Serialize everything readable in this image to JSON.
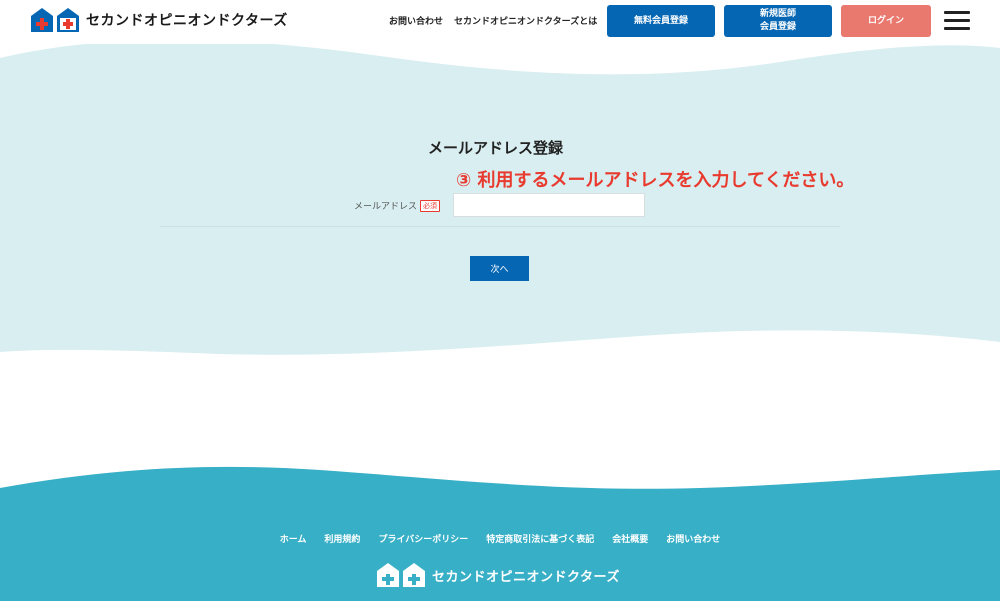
{
  "header": {
    "logo_text": "セカンドオピニオンドクターズ",
    "nav_contact": "お問い合わせ",
    "nav_about": "セカンドオピニオンドクターズとは",
    "btn_free_register": "無料会員登録",
    "btn_doctor_register_line1": "新規医師",
    "btn_doctor_register_line2": "会員登録",
    "btn_login": "ログイン"
  },
  "form": {
    "title": "メールアドレス登録",
    "annotation": "③ 利用するメールアドレスを入力してください。",
    "email_label": "メールアドレス",
    "required_badge": "必須",
    "email_value": "",
    "next_button": "次へ"
  },
  "footer": {
    "links": [
      "ホーム",
      "利用規約",
      "プライバシーポリシー",
      "特定商取引法に基づく表記",
      "会社概要",
      "お問い合わせ"
    ],
    "logo_text": "セカンドオピニオンドクターズ"
  },
  "colors": {
    "primary_blue": "#0566b3",
    "login_coral": "#e9786f",
    "light_teal_bg": "#d8eef0",
    "footer_teal": "#37afc6",
    "annotation_red": "#e83a2e"
  },
  "icons": [
    "house-cross-red-icon",
    "house-cross-blue-icon",
    "hamburger-menu-icon"
  ]
}
